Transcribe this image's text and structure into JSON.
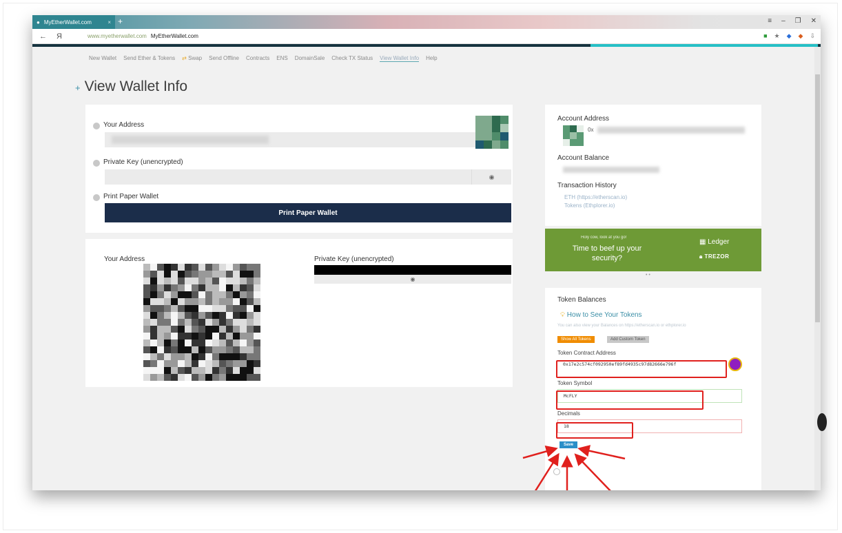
{
  "browser": {
    "tab_title": "MyEtherWallet.com",
    "tab_close": "×",
    "new_tab": "+",
    "url": "www.myetherwallet.com",
    "page_title": "MyEtherWallet.com",
    "back": "←",
    "yandex": "Я",
    "win_menu": "≡",
    "win_min": "–",
    "win_restore": "❐",
    "win_close": "✕"
  },
  "nav": {
    "items": [
      "New Wallet",
      "Send Ether & Tokens",
      "Swap",
      "Send Offline",
      "Contracts",
      "ENS",
      "DomainSale",
      "Check TX Status",
      "View Wallet Info",
      "Help"
    ],
    "active": "View Wallet Info"
  },
  "page": {
    "title": "View Wallet Info",
    "plus": "+"
  },
  "left_card": {
    "your_address_label": "Your Address",
    "private_key_label": "Private Key (unencrypted)",
    "print_label": "Print Paper Wallet",
    "print_button": "Print Paper Wallet",
    "eye": "◉"
  },
  "paper": {
    "your_address_label": "Your Address",
    "private_key_label": "Private Key (unencrypted)",
    "eye": "◉"
  },
  "account": {
    "address_label": "Account Address",
    "address_prefix": "0x",
    "balance_label": "Account Balance",
    "history_label": "Transaction History",
    "eth_link": "ETH (https://etherscan.io)",
    "tokens_link": "Tokens (Ethplorer.io)"
  },
  "promo": {
    "small": "Holy cow, look at you go!",
    "headline": "Time to beef up your security?",
    "ledger": "Ledger",
    "trezor": "TREZOR",
    "dots": "• •"
  },
  "tokens": {
    "title": "Token Balances",
    "how_to": "How to See Your Tokens",
    "hint": "You can also view your Balances on https://etherscan.io or ethplorer.io",
    "show_all": "Show All Tokens",
    "add_custom": "Add Custom Token",
    "contract_label": "Token Contract Address",
    "contract_value": "0x17e2c574cf092950ef89fd4935c97d82666e796f",
    "symbol_label": "Token Symbol",
    "symbol_value": "McFLY",
    "decimals_label": "Decimals",
    "decimals_value": "18",
    "save": "Save"
  },
  "colors": {
    "accent_dark": "#15333f",
    "accent_teal": "#26c0c6",
    "button_dark": "#1b2d4a",
    "promo_green": "#6e9a36",
    "link_blue": "#3a8ea6",
    "highlight_red": "#e0201d",
    "save_blue": "#2b8fc8",
    "show_all_orange": "#f08c00"
  }
}
